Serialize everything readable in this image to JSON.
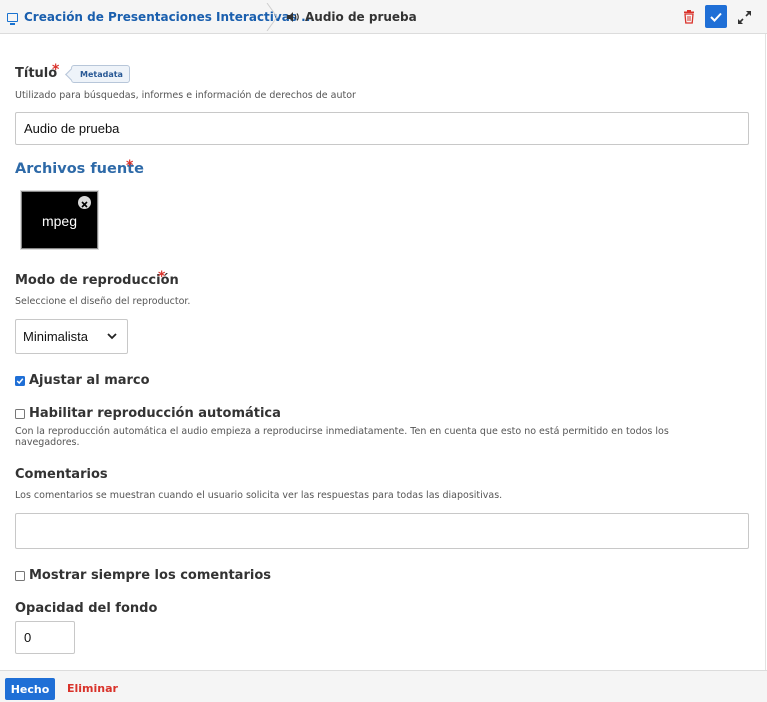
{
  "header": {
    "crumb_parent": "Creación de Presentaciones Interactivas ...",
    "crumb_current": "Audio de prueba",
    "icons": {
      "parent": "monitor-icon",
      "current": "speaker-icon",
      "delete": "trash-icon",
      "confirm": "check-icon",
      "expand": "expand-icon"
    }
  },
  "title_field": {
    "label": "Título",
    "required_mark": "*",
    "metadata_tag": "Metadata",
    "description": "Utilizado para búsquedas, informes e información de derechos de autor",
    "value": "Audio de prueba"
  },
  "sources": {
    "label": "Archivos fuente",
    "required_mark": "*",
    "file_label": "mpeg",
    "remove_icon": "close-circle-icon"
  },
  "playback": {
    "label": "Modo de reproducción",
    "required_mark": "*",
    "description": "Seleccione el diseño del reproductor.",
    "selected": "Minimalista"
  },
  "fit_frame": {
    "label": "Ajustar al marco",
    "checked": true
  },
  "autoplay": {
    "label": "Habilitar reproducción automática",
    "checked": false,
    "description_line1": "Con la reproducción automática el audio empieza a reproducirse inmediatamente. Ten en cuenta que esto no está permitido en todos los",
    "description_line2": "navegadores."
  },
  "comments": {
    "label": "Comentarios",
    "description": "Los comentarios se muestran cuando el usuario solicita ver las respuestas para todas las diapositivas.",
    "value": ""
  },
  "always_show_comments": {
    "label": "Mostrar siempre los comentarios",
    "checked": false
  },
  "background_opacity": {
    "label": "Opacidad del fondo",
    "value": "0"
  },
  "footer": {
    "done_label": "Hecho",
    "remove_label": "Eliminar"
  },
  "colors": {
    "accent": "#1f6fd6",
    "link": "#1a5fae",
    "danger": "#d9322a",
    "section_title": "#2e6aa8"
  }
}
